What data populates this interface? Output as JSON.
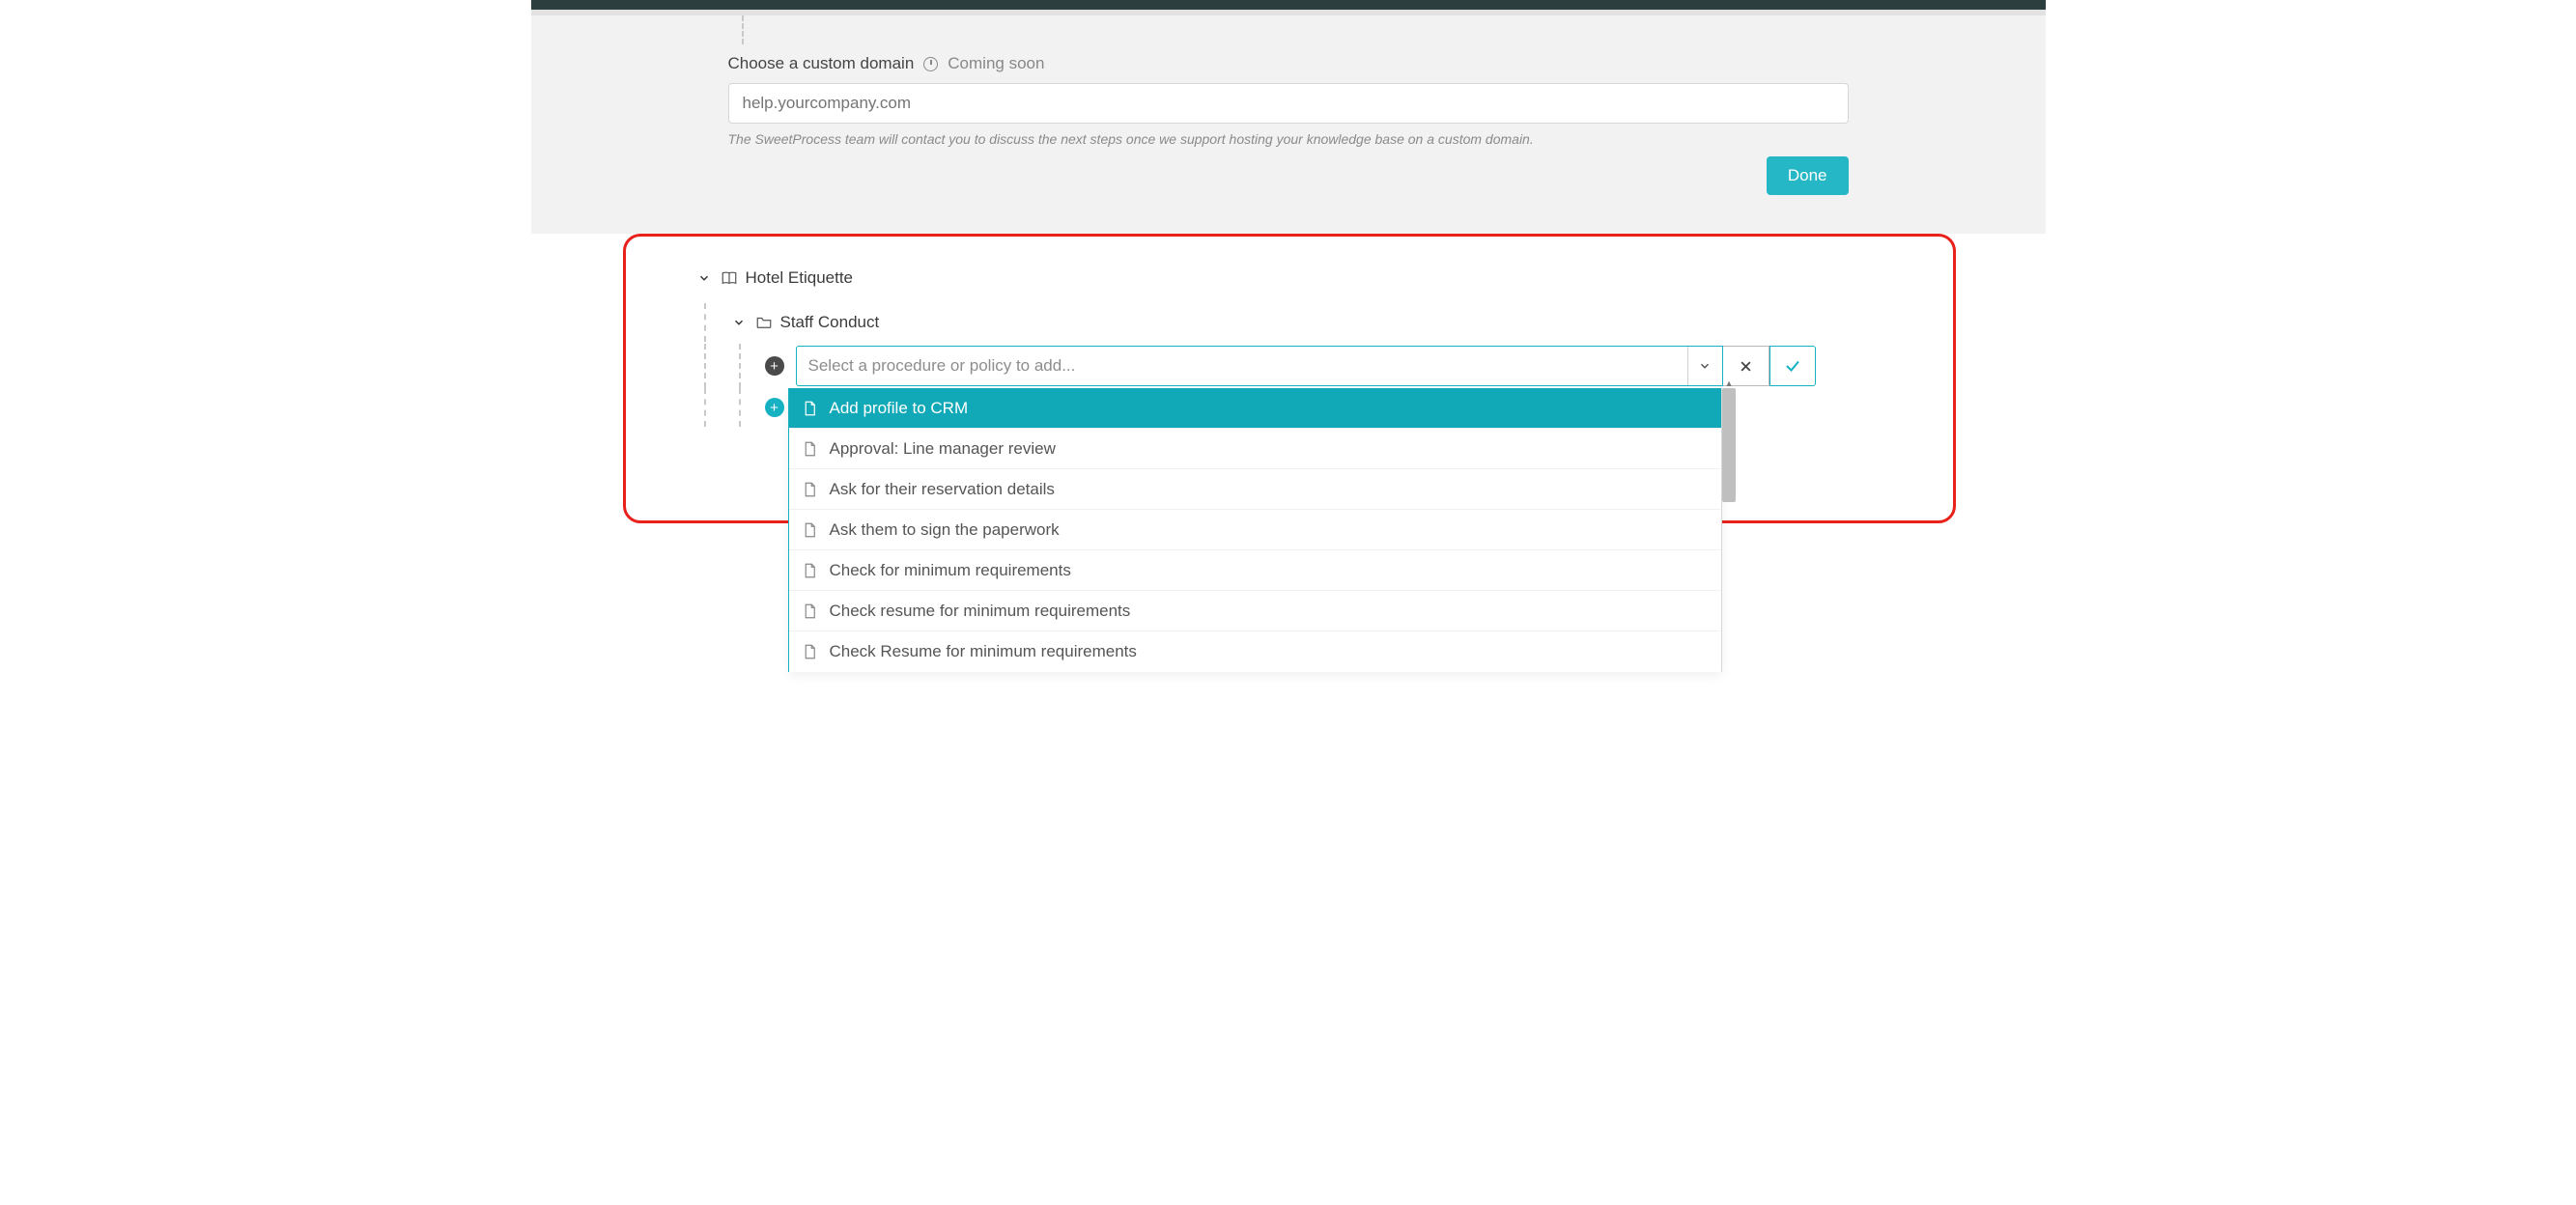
{
  "topPanel": {
    "label": "Choose a custom domain",
    "badge": "Coming soon",
    "placeholder": "help.yourcompany.com",
    "helpText": "The SweetProcess team will contact you to discuss the next steps once we support hosting your knowledge base on a custom domain.",
    "doneLabel": "Done"
  },
  "tree": {
    "root": "Hotel Etiquette",
    "folder": "Staff Conduct",
    "comboPlaceholder": "Select a procedure or policy to add...",
    "dropdown": [
      "Add profile to CRM",
      "Approval: Line manager review",
      "Ask for their reservation details",
      "Ask them to sign the paperwork",
      "Check for minimum requirements",
      "Check resume for minimum requirements",
      "Check Resume for minimum requirements"
    ]
  },
  "colors": {
    "accent": "#17b2c2",
    "highlightRed": "#e8211b"
  }
}
